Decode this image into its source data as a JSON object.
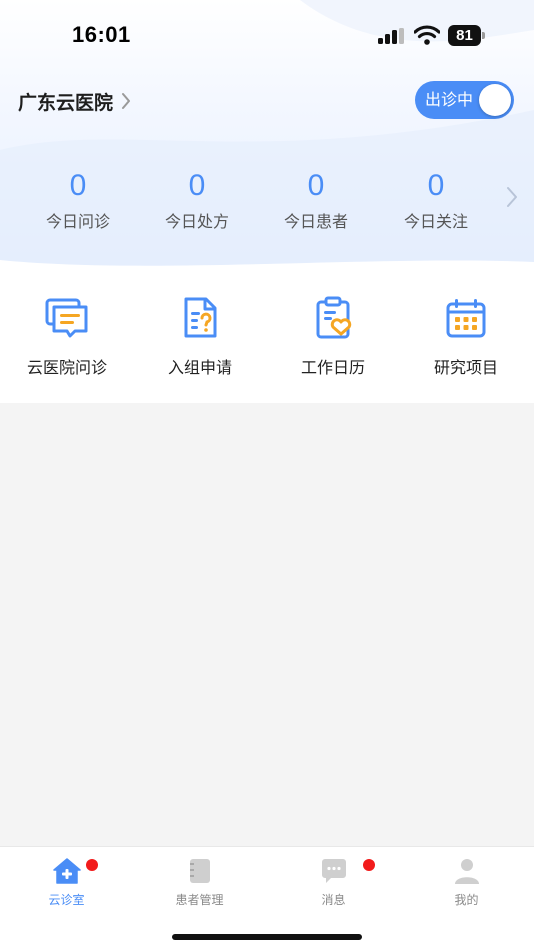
{
  "status_bar": {
    "time": "16:01",
    "battery": "81",
    "icons": [
      "cellular-signal-icon",
      "wifi-icon",
      "battery-icon"
    ]
  },
  "header": {
    "hospital_name": "广东云医院",
    "chevron_icon": "chevron-right-icon",
    "duty_toggle": {
      "label": "出诊中",
      "on": true
    }
  },
  "stats": [
    {
      "value": "0",
      "label": "今日问诊"
    },
    {
      "value": "0",
      "label": "今日处方"
    },
    {
      "value": "0",
      "label": "今日患者"
    },
    {
      "value": "0",
      "label": "今日关注"
    }
  ],
  "actions": [
    {
      "label": "云医院问诊",
      "icon": "chat-bubbles-icon"
    },
    {
      "label": "入组申请",
      "icon": "document-question-icon"
    },
    {
      "label": "工作日历",
      "icon": "clipboard-heart-icon"
    },
    {
      "label": "研究项目",
      "icon": "calendar-icon"
    }
  ],
  "tabbar": [
    {
      "label": "云诊室",
      "icon": "home-plus-icon",
      "active": true,
      "badge": true
    },
    {
      "label": "患者管理",
      "icon": "notebook-icon",
      "active": false,
      "badge": false
    },
    {
      "label": "消息",
      "icon": "message-icon",
      "active": false,
      "badge": true
    },
    {
      "label": "我的",
      "icon": "user-icon",
      "active": false,
      "badge": false
    }
  ],
  "colors": {
    "accent": "#4a8df6",
    "icon_orange": "#f5a623",
    "badge": "#f21b1b",
    "background": "#f4f4f4"
  }
}
